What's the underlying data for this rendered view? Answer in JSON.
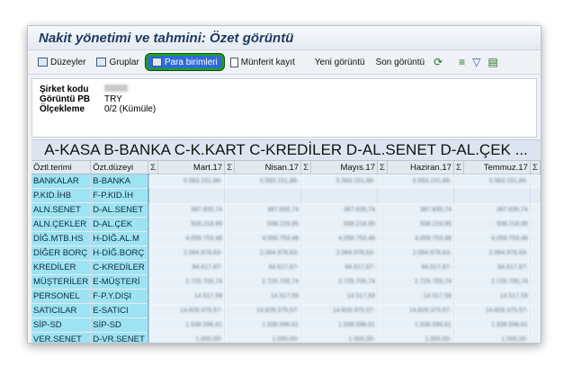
{
  "title": "Nakit yönetimi ve tahmini: Özet görüntü",
  "toolbar": {
    "duzeyler": "Düzeyler",
    "gruplar": "Gruplar",
    "para_birimleri": "Para birimleri",
    "munferit_kayit": "Münferit kayıt",
    "yeni_goruntu": "Yeni görüntü",
    "son_goruntu": "Son görüntü"
  },
  "header": {
    "company_label": "Şirket kodu",
    "view_pb_label": "Görüntü PB",
    "view_pb_value": "TRY",
    "scale_label": "Ölçekleme",
    "scale_value": "0/2 (Kümüle)"
  },
  "grid": {
    "title": "A-KASA B-BANKA C-K.KART C-KREDİLER D-AL.SENET D-AL.ÇEK ...",
    "col1": "Öztl.terimi",
    "col2": "Özt.düzeyi",
    "sigma": "Σ",
    "months": [
      "Mart.17",
      "Nisan.17",
      "Mayıs.17",
      "Haziran.17",
      "Temmuz.17"
    ],
    "rows": [
      {
        "term": "BANKALAR",
        "level": "B-BANKA",
        "v": "5.583.151,86-"
      },
      {
        "term": "P.KID.İHB",
        "level": "F-P.KID.İH",
        "v": ""
      },
      {
        "term": "ALN.SENET",
        "level": "D-AL.SENET",
        "v": "387.835,74"
      },
      {
        "term": "ALN.ÇEKLER",
        "level": "D-AL.ÇEK",
        "v": "508.218,95"
      },
      {
        "term": "DİĞ.MTB.HS",
        "level": "H-DİĞ.AL.M",
        "v": "4.059.753,48"
      },
      {
        "term": "DİĞER BORÇ",
        "level": "H-DİĞ.BORÇ",
        "v": "2.064.978,63-"
      },
      {
        "term": "KREDİLER",
        "level": "C-KREDİLER",
        "v": "84.617,87-"
      },
      {
        "term": "MÜŞTERİLER",
        "level": "E-MÜŞTERİ",
        "v": "2.725.705,74"
      },
      {
        "term": "PERSONEL",
        "level": "F-P.Y.DIŞI",
        "v": "14.517,59"
      },
      {
        "term": "SATICILAR",
        "level": "E-SATICI",
        "v": "14.828.375,57-"
      },
      {
        "term": "SİP-SD",
        "level": "SİP-SD",
        "v": "1.938.596,61"
      },
      {
        "term": "VER.SENET",
        "level": "D-VR.SENET",
        "v": "1.000,00-"
      }
    ]
  }
}
